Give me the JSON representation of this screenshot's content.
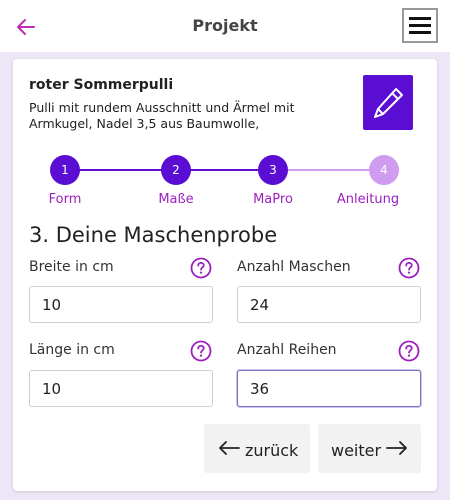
{
  "header": {
    "title": "Projekt",
    "back_icon": "arrow-left-icon",
    "menu_icon": "hamburger-menu-icon"
  },
  "project": {
    "title": "roter Sommerpulli",
    "description": "Pulli mit rundem Ausschnitt und Ärmel mit Armkugel, Nadel 3,5 aus Baumwolle,",
    "edit_icon": "pencil-icon"
  },
  "stepper": {
    "steps": [
      {
        "number": "1",
        "label": "Form",
        "state": "done"
      },
      {
        "number": "2",
        "label": "Maße",
        "state": "done"
      },
      {
        "number": "3",
        "label": "MaPro",
        "state": "active"
      },
      {
        "number": "4",
        "label": "Anleitung",
        "state": "pending"
      }
    ]
  },
  "section": {
    "title": "3. Deine Maschenprobe"
  },
  "fields": {
    "breite": {
      "label": "Breite in cm",
      "value": "10"
    },
    "maschen": {
      "label": "Anzahl Maschen",
      "value": "24"
    },
    "laenge": {
      "label": "Länge in cm",
      "value": "10"
    },
    "reihen": {
      "label": "Anzahl Reihen",
      "value": "36"
    }
  },
  "buttons": {
    "back": "zurück",
    "next": "weiter"
  },
  "colors": {
    "accent": "#9c1fc0",
    "primary": "#5b0ed3",
    "step_pending": "#cf9cf0",
    "background": "#ece6f6"
  }
}
